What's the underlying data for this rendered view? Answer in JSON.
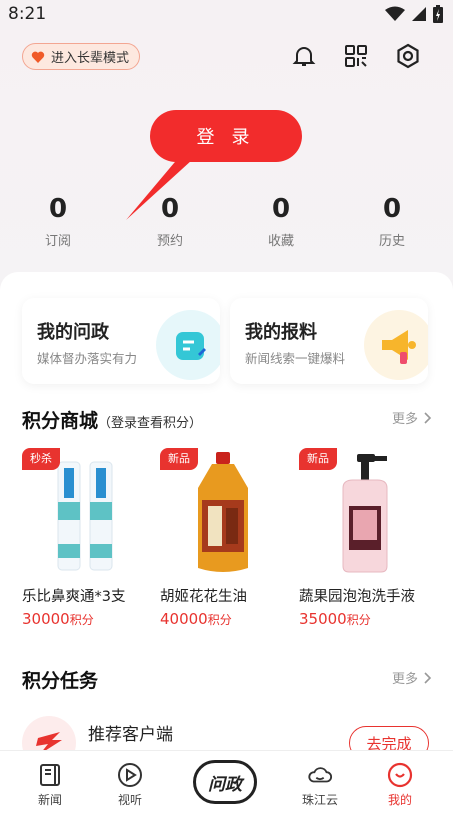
{
  "status_bar": {
    "time": "8:21"
  },
  "header": {
    "elder_mode_label": "进入长辈模式",
    "login_label": "登 录"
  },
  "stats": [
    {
      "value": "0",
      "label": "订阅"
    },
    {
      "value": "0",
      "label": "预约"
    },
    {
      "value": "0",
      "label": "收藏"
    },
    {
      "value": "0",
      "label": "历史"
    }
  ],
  "cards": [
    {
      "title": "我的问政",
      "subtitle": "媒体督办落实有力"
    },
    {
      "title": "我的报料",
      "subtitle": "新闻线索一键爆料"
    }
  ],
  "points_mall": {
    "title": "积分商城",
    "note": "（登录查看积分）",
    "more": "更多",
    "products": [
      {
        "badge": "秒杀",
        "name": "乐比鼻爽通*3支",
        "price": "30000",
        "unit": "积分"
      },
      {
        "badge": "新品",
        "name": "胡姬花花生油",
        "price": "40000",
        "unit": "积分"
      },
      {
        "badge": "新品",
        "name": "蔬果园泡泡洗手液",
        "price": "35000",
        "unit": "积分"
      }
    ]
  },
  "points_tasks": {
    "title": "积分任务",
    "more": "更多",
    "items": [
      {
        "title": "推荐客户端",
        "button": "去完成"
      }
    ]
  },
  "tabbar": {
    "items": [
      {
        "label": "新闻",
        "icon": "news-icon"
      },
      {
        "label": "视听",
        "icon": "play-icon"
      },
      {
        "label": "问政",
        "icon": "wenzheng-icon"
      },
      {
        "label": "珠江云",
        "icon": "cloud-icon"
      },
      {
        "label": "我的",
        "icon": "profile-icon"
      }
    ],
    "active": "我的"
  },
  "colors": {
    "accent": "#e8332f",
    "login": "#f22c2c"
  }
}
